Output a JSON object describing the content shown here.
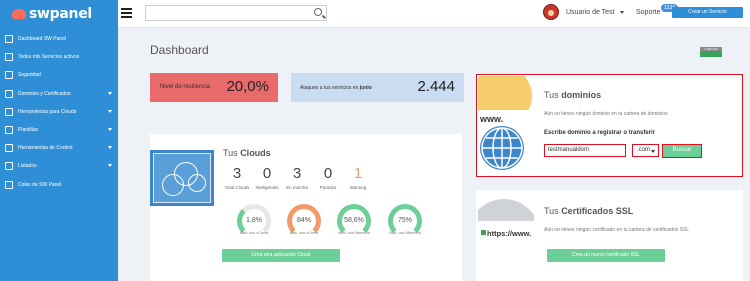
{
  "brand": {
    "name": "swpanel"
  },
  "header": {
    "search_placeholder": "",
    "user": "Usuario de Test",
    "support": "Soporte",
    "support_badge": "1230",
    "new_service": "Crear un Servicio"
  },
  "sidebar": {
    "items": [
      {
        "label": "Dashboard SW Panel",
        "icon": "dashboard-icon",
        "arrow": false
      },
      {
        "label": "Todos mis Servicios activos",
        "icon": "list-icon",
        "arrow": false
      },
      {
        "label": "Seguridad",
        "icon": "shield-icon",
        "arrow": false
      },
      {
        "label": "Dominios y Certificados",
        "icon": "gear-icon",
        "arrow": true
      },
      {
        "label": "Herramientas para Clouds",
        "icon": "cloud-icon",
        "arrow": true
      },
      {
        "label": "Plantillas",
        "icon": "template-icon",
        "arrow": true
      },
      {
        "label": "Herramientas de Control",
        "icon": "check-icon",
        "arrow": true
      },
      {
        "label": "Listados",
        "icon": "list-icon",
        "arrow": true
      },
      {
        "label": "Colas de SW Panel",
        "icon": "queue-icon",
        "arrow": false
      }
    ]
  },
  "page": {
    "title": "Dashboard",
    "pill": "2.000.000"
  },
  "resilience": {
    "label": "Nivel de resiliencia",
    "value": "20,0%"
  },
  "attacks": {
    "label": "Ataques a tus servicios en",
    "month": "junio",
    "value": "2.444"
  },
  "clouds": {
    "title_pre": "Tus",
    "title": "Clouds",
    "stats": [
      {
        "value": "3",
        "label": "Total Clouds",
        "color": "#444"
      },
      {
        "value": "0",
        "label": "Inteligentes",
        "color": "#444"
      },
      {
        "value": "3",
        "label": "En marcha",
        "color": "#444"
      },
      {
        "value": "0",
        "label": "Parados",
        "color": "#444"
      },
      {
        "value": "1",
        "label": "Warning",
        "color": "#f0a070"
      }
    ],
    "gauges": [
      {
        "value": "1,8%",
        "label": "Med. uso vCores",
        "pct": 1.8,
        "color": "#6ccf98"
      },
      {
        "value": "84%",
        "label": "Max. uso vCores",
        "pct": 84,
        "color": "#f49a6a"
      },
      {
        "value": "58,6%",
        "label": "Med. uso Memoria",
        "pct": 58.6,
        "color": "#6ccf98"
      },
      {
        "value": "75%",
        "label": "Max. uso Memoria",
        "pct": 75,
        "color": "#6ccf98"
      }
    ],
    "button": "Crea otra aplicación Cloud"
  },
  "domains": {
    "title_pre": "Tus",
    "title": "dominios",
    "text": "Aún no tienes ningún dominio en tu cartera de dominios",
    "label": "Escribe dominio a registrar o transferir",
    "input": "testmanualdom",
    "tld": ".com",
    "button": "Buscar",
    "img_text": "www."
  },
  "ssl": {
    "title_pre": "Tus",
    "title": "Certificados SSL",
    "text": "Aún no tienes ningún certificado en tu cartera de certificados SSL",
    "button": "Crea un nuevo certificado SSL",
    "img_text": "https://www."
  }
}
